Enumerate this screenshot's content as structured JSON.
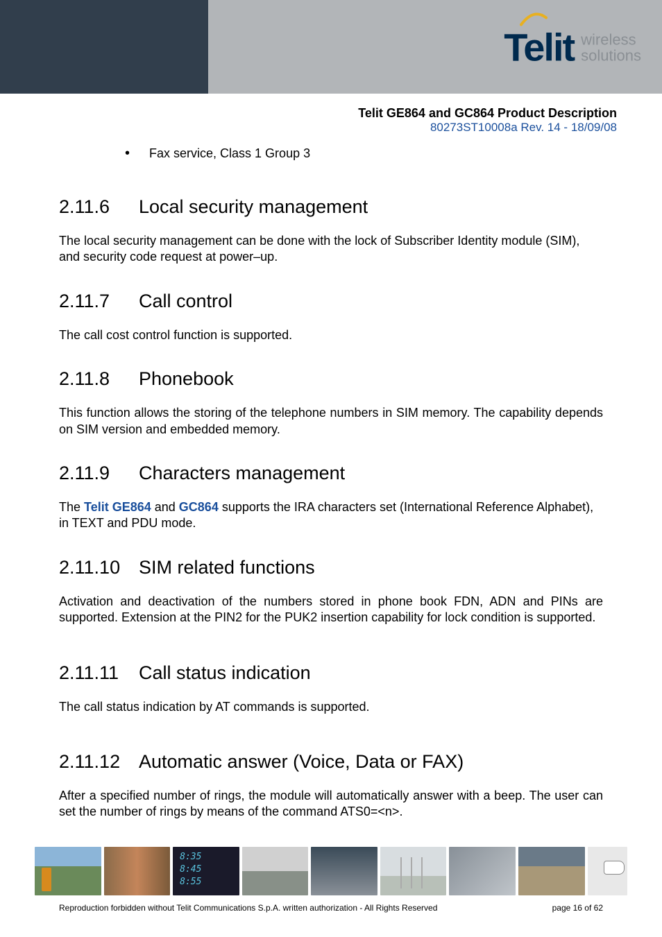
{
  "header": {
    "brand": "Telit",
    "tagline_l1": "wireless",
    "tagline_l2": "solutions",
    "doc_title": "Telit GE864 and GC864 Product Description",
    "doc_rev": "80273ST10008a Rev. 14 - 18/09/08"
  },
  "bullet": {
    "text": "Fax service, Class 1 Group 3"
  },
  "sections": {
    "s6": {
      "num": "2.11.6",
      "title": "Local security management",
      "body": "The local security management can be done with the lock of Subscriber Identity module (SIM), and security code request at power–up."
    },
    "s7": {
      "num": "2.11.7",
      "title": "Call control",
      "body": "The call cost control function is supported."
    },
    "s8": {
      "num": "2.11.8",
      "title": "Phonebook",
      "body": "This function allows the storing of the telephone numbers in SIM memory. The capability depends on SIM version and embedded memory."
    },
    "s9": {
      "num": "2.11.9",
      "title": "Characters management",
      "body_pre": "The ",
      "body_b1": "Telit GE864",
      "body_mid1": " and ",
      "body_b2": "GC864",
      "body_post": " supports the IRA characters set (International Reference Alphabet), in TEXT and PDU mode."
    },
    "s10": {
      "num": "2.11.10",
      "title": "SIM related functions",
      "body": "Activation and deactivation of the numbers stored in phone book FDN, ADN and PINs are supported. Extension at the PIN2 for the PUK2 insertion capability for lock condition is supported."
    },
    "s11": {
      "num": "2.11.11",
      "title": "Call status indication",
      "body": "The call status indication by AT commands is supported."
    },
    "s12": {
      "num": "2.11.12",
      "title": "Automatic answer (Voice, Data or FAX)",
      "body": "After a specified number of rings, the module will automatically answer with a beep. The user can set the number of rings by means of the command ATS0=<n>."
    }
  },
  "footer": {
    "left": "Reproduction forbidden without Telit Communications S.p.A. written authorization - All Rights Reserved",
    "right": "page 16 of 62"
  }
}
